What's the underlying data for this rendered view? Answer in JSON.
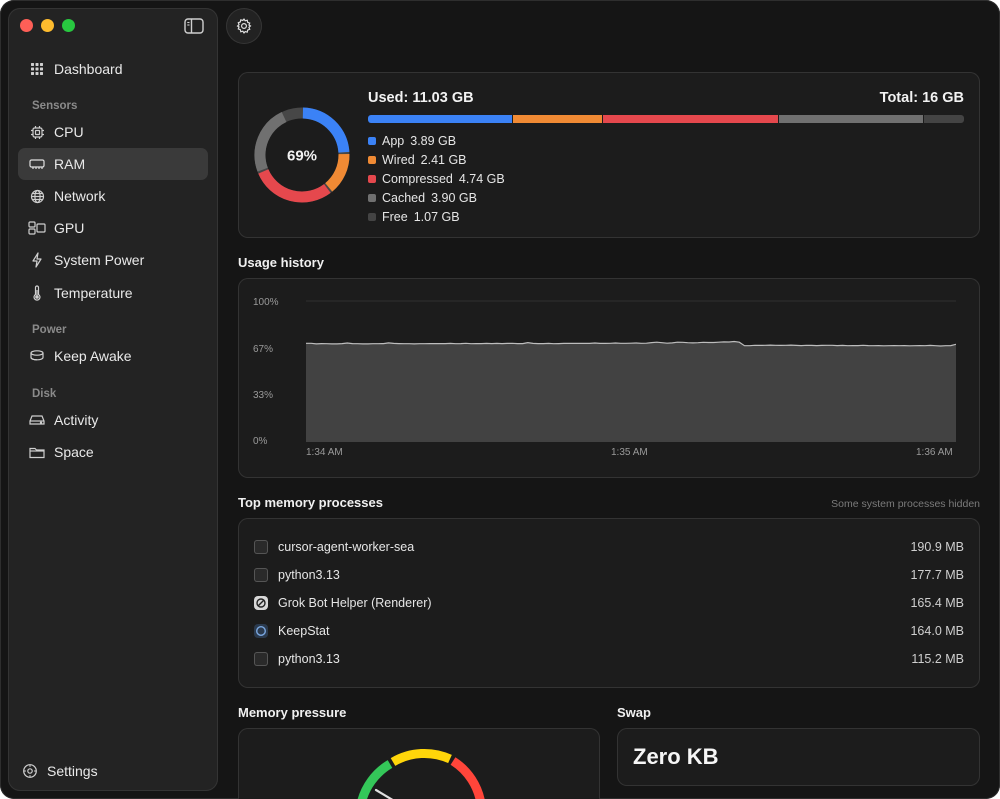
{
  "sidebar": {
    "items": [
      {
        "label": "Dashboard",
        "icon": "grid-icon",
        "active": false
      },
      {
        "label": "CPU",
        "icon": "chip-icon",
        "active": false
      },
      {
        "label": "RAM",
        "icon": "memory-icon",
        "active": true
      },
      {
        "label": "Network",
        "icon": "globe-icon",
        "active": false
      },
      {
        "label": "GPU",
        "icon": "gpu-icon",
        "active": false
      },
      {
        "label": "System Power",
        "icon": "bolt-icon",
        "active": false
      },
      {
        "label": "Temperature",
        "icon": "thermometer-icon",
        "active": false
      },
      {
        "label": "Keep Awake",
        "icon": "cup-icon",
        "active": false
      },
      {
        "label": "Activity",
        "icon": "drive-icon",
        "active": false
      },
      {
        "label": "Space",
        "icon": "folder-icon",
        "active": false
      }
    ],
    "sections": {
      "sensors": "Sensors",
      "power": "Power",
      "disk": "Disk"
    },
    "settings_label": "Settings"
  },
  "summary": {
    "percent": "69%",
    "percent_value": 69,
    "used_label": "Used: 11.03 GB",
    "total_label": "Total: 16 GB",
    "segments": [
      {
        "name": "App",
        "value": "3.89 GB",
        "gb": 3.89,
        "color": "#3b82f6"
      },
      {
        "name": "Wired",
        "value": "2.41 GB",
        "gb": 2.41,
        "color": "#f08a34"
      },
      {
        "name": "Compressed",
        "value": "4.74 GB",
        "gb": 4.74,
        "color": "#e5484d"
      },
      {
        "name": "Cached",
        "value": "3.90 GB",
        "gb": 3.9,
        "color": "#707070"
      },
      {
        "name": "Free",
        "value": "1.07 GB",
        "gb": 1.07,
        "color": "#444444"
      }
    ]
  },
  "history": {
    "title": "Usage history",
    "y_ticks": [
      "100%",
      "67%",
      "33%",
      "0%"
    ],
    "x_ticks": [
      "1:34 AM",
      "1:35 AM",
      "1:36 AM"
    ],
    "values": [
      70,
      70,
      69.6,
      69.8,
      69.7,
      69.6,
      69.6,
      69.8,
      70.2,
      69.8,
      69.7,
      69.6,
      69.6,
      69.7,
      69.7,
      69.8,
      70.3,
      69.9,
      69.8,
      69.7,
      69.7,
      69.6,
      69.7,
      69.7,
      69.8,
      69.8,
      69.8,
      69.8,
      69.9,
      69.7,
      69.8,
      70.0,
      69.7,
      69.8,
      69.8,
      69.9,
      69.8,
      69.9,
      69.8,
      69.9,
      70.0,
      69.8,
      69.8,
      70.5,
      69.9,
      69.8,
      69.8,
      69.9,
      69.7,
      69.8,
      69.9,
      69.9,
      70.0,
      69.9,
      70.0,
      69.9,
      70.2,
      69.9,
      69.9,
      70.0,
      70.2,
      70.0,
      70.0,
      70.1,
      70.2,
      70.0,
      70.1,
      70.5,
      70.8,
      70.4,
      70.1,
      70.3,
      70.8,
      70.7,
      70.4,
      70.3,
      70.4,
      70.7,
      70.6,
      70.6,
      70.8,
      71.0,
      70.9,
      71.3,
      70.8,
      68.3,
      68.3,
      68.6,
      68.5,
      68.6,
      68.7,
      68.6,
      68.5,
      68.6,
      68.7,
      68.5,
      68.4,
      68.6,
      68.5,
      68.4,
      68.5,
      68.6,
      68.6,
      68.4,
      68.5,
      68.3,
      68.4,
      68.4,
      68.6,
      68.4,
      68.3,
      68.4,
      68.2,
      68.3,
      68.4,
      68.3,
      68.4,
      68.2,
      68.3,
      68.4,
      68.3,
      68.5,
      68.3,
      68.1,
      68.3,
      68.4,
      69.3
    ]
  },
  "processes": {
    "title": "Top memory processes",
    "hint": "Some system processes hidden",
    "rows": [
      {
        "name": "cursor-agent-worker-sea",
        "mem": "190.9 MB",
        "icon": "terminal-icon"
      },
      {
        "name": "python3.13",
        "mem": "177.7 MB",
        "icon": "terminal-icon"
      },
      {
        "name": "Grok Bot Helper (Renderer)",
        "mem": "165.4 MB",
        "icon": "grok-app-icon"
      },
      {
        "name": "KeepStat",
        "mem": "164.0 MB",
        "icon": "keepstat-app-icon"
      },
      {
        "name": "python3.13",
        "mem": "115.2 MB",
        "icon": "terminal-icon"
      }
    ]
  },
  "pressure": {
    "title": "Memory pressure"
  },
  "swap": {
    "title": "Swap",
    "value": "Zero KB"
  },
  "colors": {
    "accent_green": "#34c759",
    "accent_yellow": "#ffd60a",
    "accent_red": "#ff453a"
  }
}
